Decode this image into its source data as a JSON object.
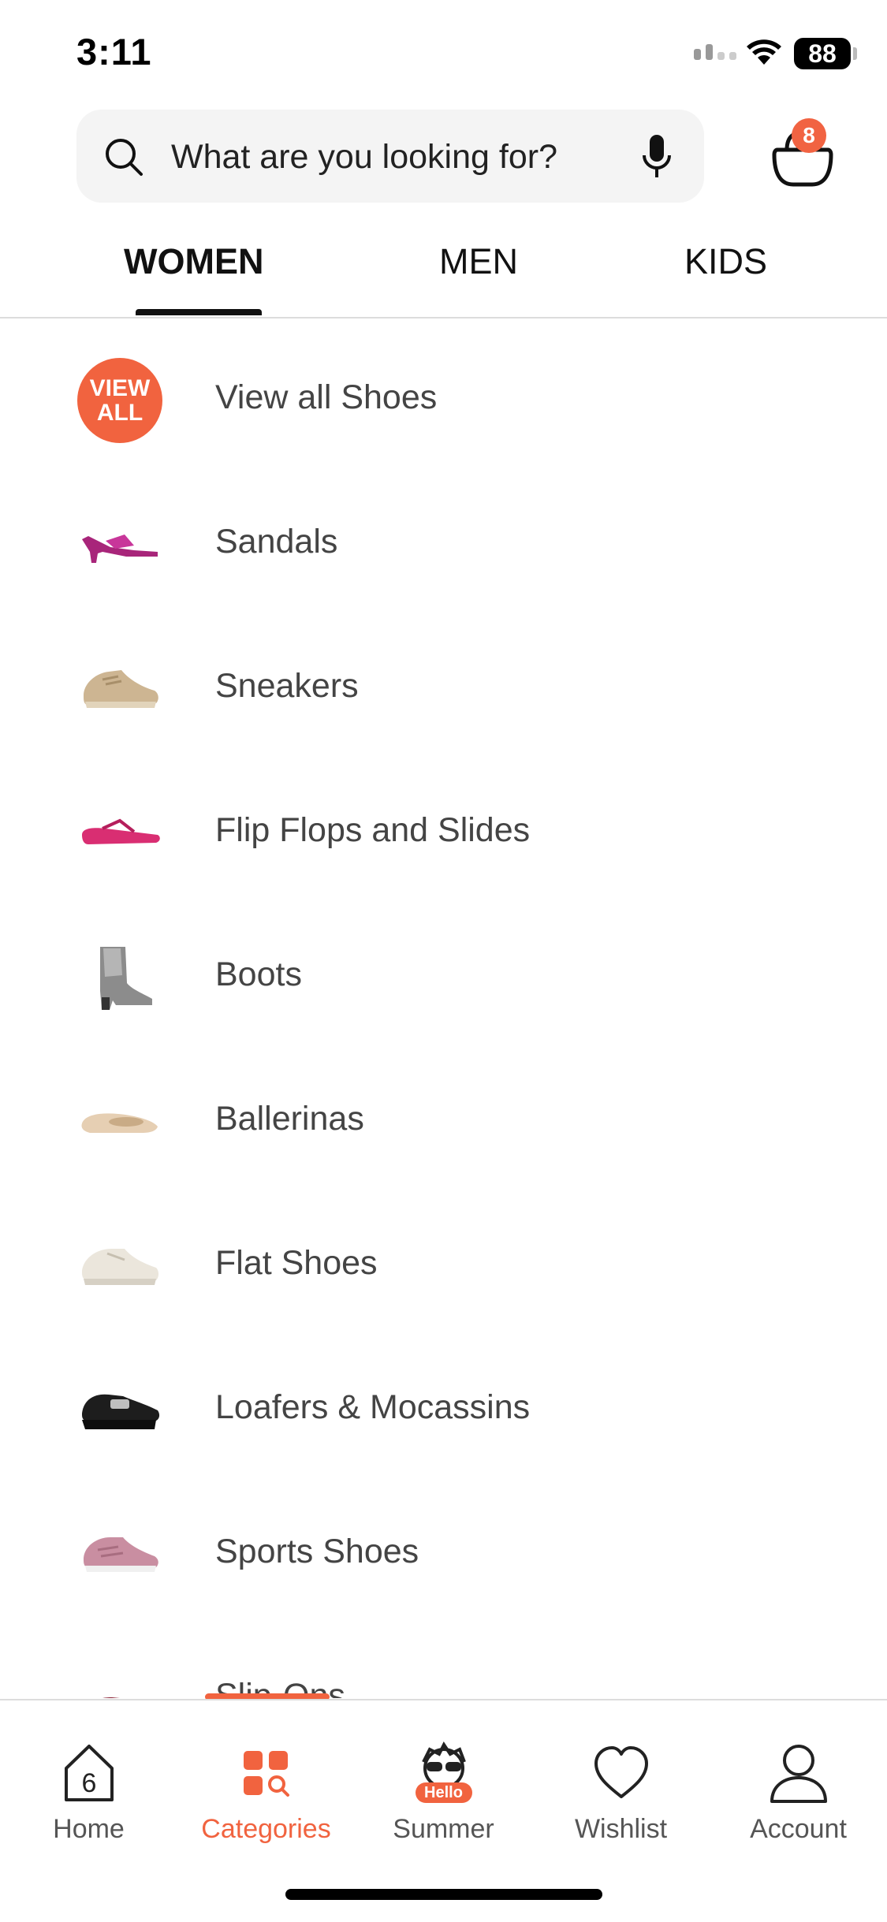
{
  "status_bar": {
    "time": "3:11",
    "battery": "88"
  },
  "search": {
    "placeholder": "What are you looking for?"
  },
  "cart": {
    "badge_count": "8"
  },
  "tabs": [
    {
      "label": "WOMEN",
      "active": true
    },
    {
      "label": "MEN",
      "active": false
    },
    {
      "label": "KIDS",
      "active": false
    }
  ],
  "view_all_badge": {
    "line1": "VIEW",
    "line2": "ALL"
  },
  "categories": [
    {
      "label": "View all Shoes",
      "icon": "view-all-badge"
    },
    {
      "label": "Sandals",
      "icon": "sandal-icon"
    },
    {
      "label": "Sneakers",
      "icon": "sneaker-icon"
    },
    {
      "label": "Flip Flops and Slides",
      "icon": "flip-flop-icon"
    },
    {
      "label": "Boots",
      "icon": "boot-icon"
    },
    {
      "label": "Ballerinas",
      "icon": "ballerina-icon"
    },
    {
      "label": "Flat Shoes",
      "icon": "flat-shoe-icon"
    },
    {
      "label": "Loafers & Mocassins",
      "icon": "loafer-icon"
    },
    {
      "label": "Sports Shoes",
      "icon": "sports-shoe-icon"
    },
    {
      "label": "Slip-Ons",
      "icon": "slip-on-icon"
    }
  ],
  "bottom_nav": [
    {
      "label": "Home",
      "icon": "home-icon",
      "active": false
    },
    {
      "label": "Categories",
      "icon": "categories-icon",
      "active": true
    },
    {
      "label": "Summer",
      "icon": "summer-icon",
      "badge": "Hello",
      "active": false
    },
    {
      "label": "Wishlist",
      "icon": "heart-icon",
      "active": false
    },
    {
      "label": "Account",
      "icon": "account-icon",
      "active": false
    }
  ],
  "colors": {
    "accent": "#f1633f",
    "text": "#1a1a1a",
    "muted": "#555555",
    "divider": "#dcdcdc"
  }
}
